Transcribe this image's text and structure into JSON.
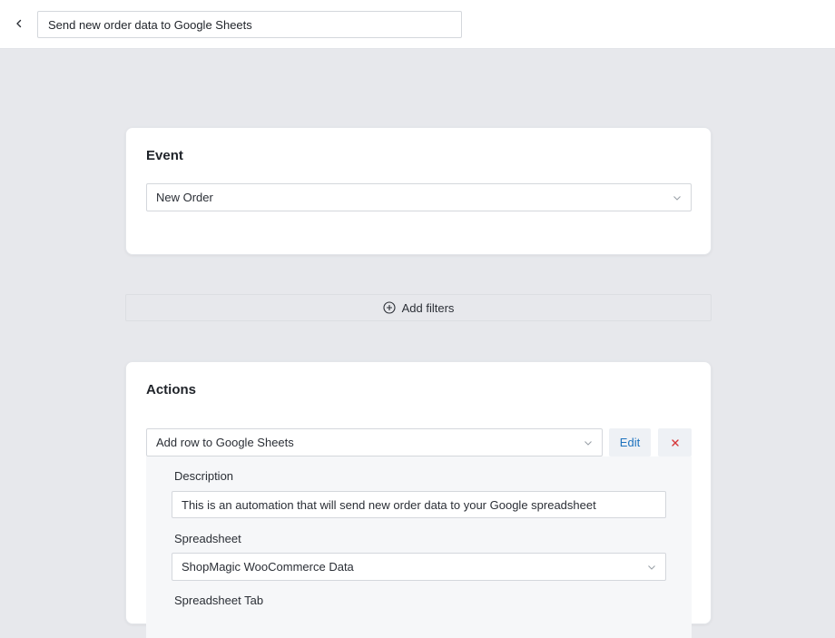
{
  "header": {
    "back_icon": "chevron-left-icon",
    "title_value": "Send new order data to Google Sheets"
  },
  "event_card": {
    "title": "Event",
    "event_select_value": "New Order"
  },
  "filters": {
    "label": "Add filters",
    "icon": "plus-circle-icon"
  },
  "actions_card": {
    "title": "Actions",
    "action_select_value": "Add row to Google Sheets",
    "edit_label": "Edit",
    "remove_icon": "close-icon",
    "fields": {
      "description_label": "Description",
      "description_value": "This is an automation that will send new order data to your Google spreadsheet",
      "spreadsheet_label": "Spreadsheet",
      "spreadsheet_value": "ShopMagic WooCommerce Data",
      "spreadsheet_tab_label": "Spreadsheet Tab"
    }
  },
  "colors": {
    "page_bg": "#e7e8ec",
    "accent": "#1e73be",
    "danger": "#d63638"
  }
}
